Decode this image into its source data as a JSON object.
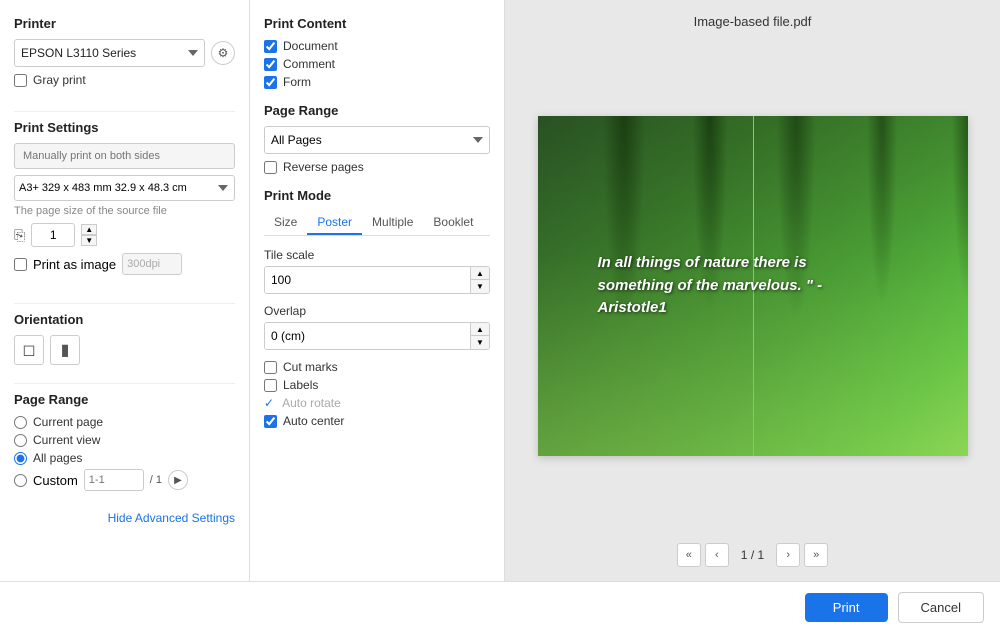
{
  "window": {
    "title": "Image-based file.pdf"
  },
  "left": {
    "printer_label": "Printer",
    "printer_value": "EPSON L3110 Series",
    "gray_print_label": "Gray print",
    "print_settings_label": "Print Settings",
    "both_sides_placeholder": "Manually print on both sides",
    "paper_size_value": "A3+ 329 x 483 mm 32.9 x 48.3 cm",
    "page_size_hint": "The page size of the source file",
    "copies_value": "1",
    "print_as_image_label": "Print as image",
    "dpi_value": "300dpi",
    "orientation_label": "Orientation",
    "page_range_label": "Page Range",
    "current_page_label": "Current page",
    "current_view_label": "Current view",
    "all_pages_label": "All pages",
    "custom_label": "Custom",
    "custom_placeholder": "1-1",
    "of_label": "/ 1",
    "hide_advanced_label": "Hide Advanced Settings"
  },
  "middle": {
    "print_content_label": "Print Content",
    "document_label": "Document",
    "comment_label": "Comment",
    "form_label": "Form",
    "page_range_label": "Page Range",
    "all_pages_label": "All Pages",
    "reverse_pages_label": "Reverse pages",
    "print_mode_label": "Print Mode",
    "tabs": [
      {
        "label": "Size",
        "active": false
      },
      {
        "label": "Poster",
        "active": true
      },
      {
        "label": "Multiple",
        "active": false
      },
      {
        "label": "Booklet",
        "active": false
      }
    ],
    "tile_scale_label": "Tile scale",
    "tile_scale_value": "100",
    "overlap_label": "Overlap",
    "overlap_value": "0 (cm)",
    "cut_marks_label": "Cut marks",
    "labels_label": "Labels",
    "auto_rotate_label": "Auto rotate",
    "auto_center_label": "Auto center"
  },
  "preview": {
    "quote": "In all things of nature there is something of the marvelous. \" - Aristotle1"
  },
  "pagination": {
    "current": "1",
    "total": "1"
  },
  "footer": {
    "print_label": "Print",
    "cancel_label": "Cancel"
  }
}
